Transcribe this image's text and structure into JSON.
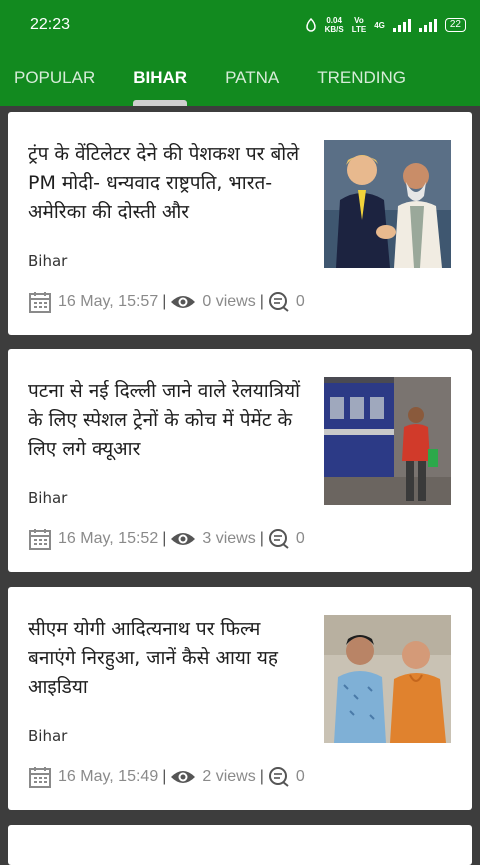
{
  "status_bar": {
    "time": "22:23",
    "net_speed_top": "0.04",
    "net_speed_bottom": "KB/S",
    "volte_top": "Vo",
    "volte_bottom": "LTE",
    "network": "4G",
    "battery": "22"
  },
  "tabs": [
    {
      "label": "POPULAR",
      "active": false
    },
    {
      "label": "BIHAR",
      "active": true
    },
    {
      "label": "PATNA",
      "active": false
    },
    {
      "label": "TRENDING",
      "active": false
    }
  ],
  "articles": [
    {
      "title": "ट्रंप के वेंटिलेटर देने की पेशकश पर बोले PM मोदी- धन्यवाद राष्ट्रपति, भारत-अमेरिका की दोस्ती और",
      "category": "Bihar",
      "date": "16 May, 15:57",
      "views": "0 views",
      "comments": "0"
    },
    {
      "title": "पटना से नई दिल्ली जाने वाले रेलयात्रियों के लिए स्पेशल ट्रेनों के कोच में पेमेंट के लिए लगे क्यूआर",
      "category": "Bihar",
      "date": "16 May, 15:52",
      "views": "3 views",
      "comments": "0"
    },
    {
      "title": "सीएम योगी आदित्यनाथ पर फिल्म बनाएंगे निरहुआ, जानें कैसे आया यह आइडिया",
      "category": "Bihar",
      "date": "16 May, 15:49",
      "views": "2 views",
      "comments": "0"
    }
  ],
  "colors": {
    "header_green": "#128a1f",
    "background": "#3d3d3d"
  }
}
